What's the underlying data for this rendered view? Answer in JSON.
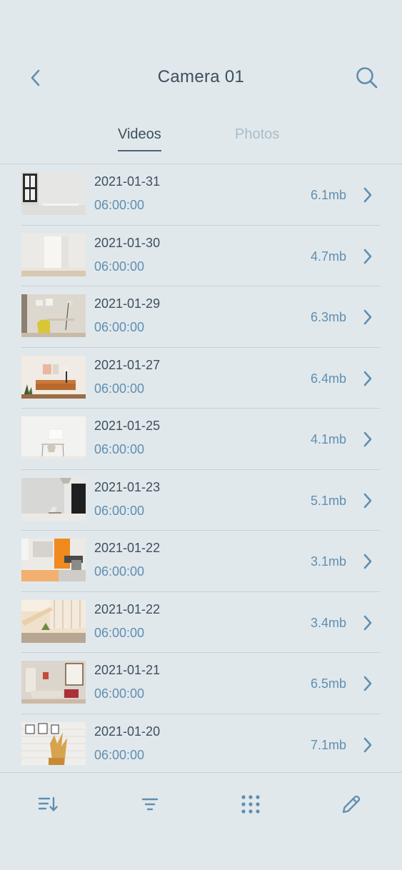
{
  "header": {
    "title": "Camera 01",
    "back_icon": "chevron-left-icon",
    "search_icon": "search-icon"
  },
  "tabs": [
    {
      "label": "Videos",
      "active": true
    },
    {
      "label": "Photos",
      "active": false
    }
  ],
  "videos": [
    {
      "date": "2021-01-31",
      "time": "06:00:00",
      "size": "6.1mb"
    },
    {
      "date": "2021-01-30",
      "time": "06:00:00",
      "size": "4.7mb"
    },
    {
      "date": "2021-01-29",
      "time": "06:00:00",
      "size": "6.3mb"
    },
    {
      "date": "2021-01-27",
      "time": "06:00:00",
      "size": "6.4mb"
    },
    {
      "date": "2021-01-25",
      "time": "06:00:00",
      "size": "4.1mb"
    },
    {
      "date": "2021-01-23",
      "time": "06:00:00",
      "size": "5.1mb"
    },
    {
      "date": "2021-01-22",
      "time": "06:00:00",
      "size": "3.1mb"
    },
    {
      "date": "2021-01-22",
      "time": "06:00:00",
      "size": "3.4mb"
    },
    {
      "date": "2021-01-21",
      "time": "06:00:00",
      "size": "6.5mb"
    },
    {
      "date": "2021-01-20",
      "time": "06:00:00",
      "size": "7.1mb"
    }
  ],
  "toolbar": {
    "sort_icon": "sort-icon",
    "filter_icon": "filter-icon",
    "grid_icon": "grid-icon",
    "edit_icon": "pencil-icon"
  },
  "colors": {
    "background": "#e1e8ec",
    "text_dark": "#3d4f5c",
    "accent_blue": "#5f8fb0",
    "tab_inactive": "#a9bcc7",
    "icon": "#5f8fb0"
  }
}
